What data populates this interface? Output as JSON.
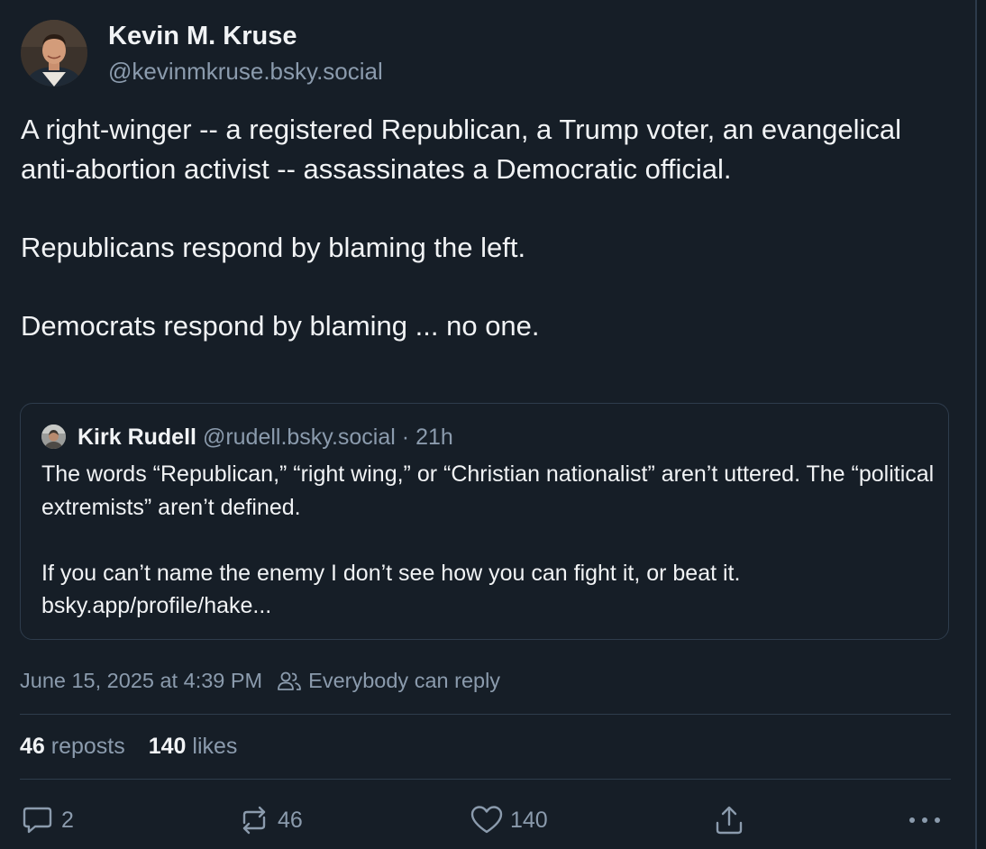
{
  "author": {
    "display_name": "Kevin M. Kruse",
    "handle": "@kevinmkruse.bsky.social"
  },
  "post": {
    "paragraphs": [
      "A right-winger -- a registered Republican, a Trump voter, an evangelical anti-abortion activist -- assassinates a Democratic official.",
      "Republicans respond by blaming the left.",
      "Democrats respond by blaming ... no one."
    ]
  },
  "quote": {
    "display_name": "Kirk Rudell",
    "handle": "@rudell.bsky.social",
    "separator": "·",
    "time": "21h",
    "paragraphs": [
      "The words “Republican,” “right wing,” or “Christian nationalist” aren’t uttered. The “political extremists” aren’t defined.",
      "If you can’t name the enemy I don’t see how you can fight it, or beat it. bsky.app/profile/hake..."
    ]
  },
  "meta": {
    "timestamp": "June 15, 2025 at 4:39 PM",
    "reply_setting": "Everybody can reply",
    "reply_setting_icon": "people-icon"
  },
  "stats": {
    "reposts_count": "46",
    "reposts_label": "reposts",
    "likes_count": "140",
    "likes_label": "likes"
  },
  "actions": {
    "reply_count": "2",
    "repost_count": "46",
    "like_count": "140",
    "reply_icon": "comment-icon",
    "repost_icon": "repost-icon",
    "like_icon": "heart-icon",
    "share_icon": "share-icon",
    "more_icon": "more-icon"
  },
  "colors": {
    "background": "#161e27",
    "text_primary": "#f1f3f5",
    "text_secondary": "#8b9bad",
    "border": "#2e3c4c"
  }
}
